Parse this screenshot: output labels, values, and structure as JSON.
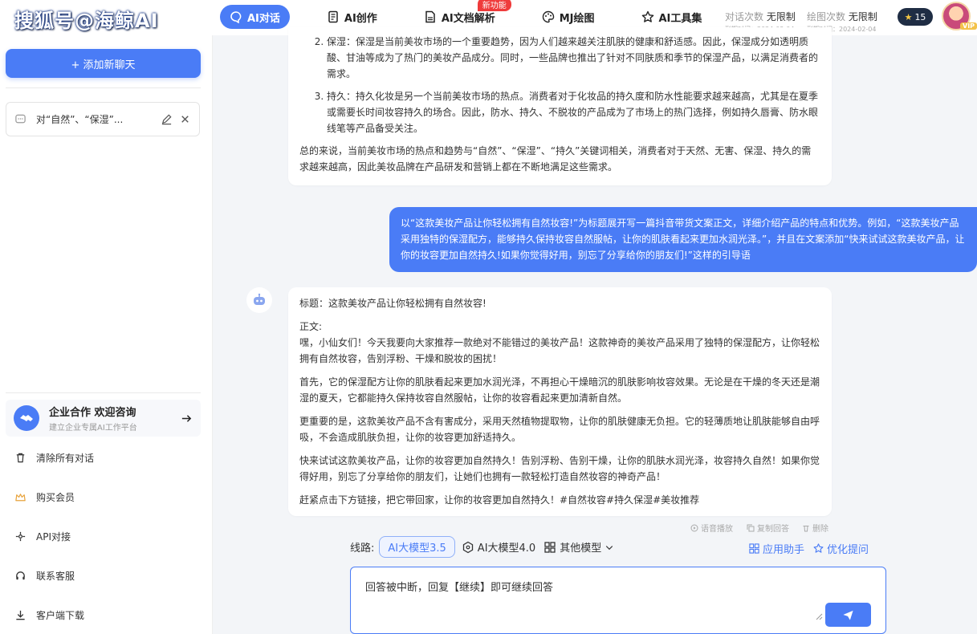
{
  "watermark": "搜狐号@海鲸AI",
  "nav": {
    "items": [
      {
        "label": "AI对话",
        "icon": "chat-icon",
        "active": true
      },
      {
        "label": "AI创作",
        "icon": "doc-icon"
      },
      {
        "label": "AI文档解析",
        "icon": "pdf-icon",
        "badge": "新功能"
      },
      {
        "label": "MJ绘图",
        "icon": "palette-icon"
      },
      {
        "label": "AI工具集",
        "icon": "star-icon"
      }
    ]
  },
  "quota": {
    "chat": {
      "label": "对话次数",
      "value": "无限制",
      "expiry": "到期时间：2024-02-04"
    },
    "draw": {
      "label": "绘图次数",
      "value": "无限制",
      "expiry": "到期时间：2024-02-04"
    }
  },
  "coins": "15",
  "vip_label": "VIP",
  "sidebar": {
    "add_chat": "+ 添加新聊天",
    "chat_item": "对“自然”、“保湿”...",
    "enterprise": {
      "title": "企业合作 欢迎咨询",
      "subtitle": "建立企业专属AI工作平台"
    },
    "menu": [
      {
        "label": "清除所有对话",
        "icon": "trash-icon"
      },
      {
        "label": "购买会员",
        "icon": "crown-icon"
      },
      {
        "label": "API对接",
        "icon": "api-icon"
      },
      {
        "label": "联系客服",
        "icon": "headset-icon"
      },
      {
        "label": "客户端下载",
        "icon": "download-icon"
      }
    ]
  },
  "messages": {
    "prev_bot": {
      "list": [
        {
          "num": "2.",
          "text": "保湿：保湿是当前美妆市场的一个重要趋势，因为人们越来越关注肌肤的健康和舒适感。因此，保湿成分如透明质酸、甘油等成为了热门的美妆产品成分。同时，一些品牌也推出了针对不同肤质和季节的保湿产品，以满足消费者的需求。"
        },
        {
          "num": "3.",
          "text": "持久：持久化妆是另一个当前美妆市场的热点。消费者对于化妆品的持久度和防水性能要求越来越高，尤其是在夏季或需要长时间妆容持久的场合。因此，防水、持久、不脱妆的产品成为了市场上的热门选择，例如持久唇膏、防水眼线笔等产品备受关注。"
        }
      ],
      "summary": "总的来说，当前美妆市场的热点和趋势与“自然”、“保湿”、“持久”关键词相关，消费者对于天然、无害、保湿、持久的需求越来越高，因此美妆品牌在产品研发和营销上都在不断地满足这些需求。"
    },
    "user": "以“这款美妆产品让你轻松拥有自然妆容!”为标题展开写一篇抖音带货文案正文，详细介绍产品的特点和优势。例如，“这款美妆产品采用独特的保湿配方，能够持久保持妆容自然服帖，让你的肌肤看起来更加水润光泽。”，并且在文案添加“快来试试这款美妆产品，让你的妆容更加自然持久!如果你觉得好用，别忘了分享给你的朋友们!”这样的引导语",
    "bot": {
      "title": "标题：这款美妆产品让你轻松拥有自然妆容!",
      "body_label": "正文:",
      "p1": "嘿，小仙女们！今天我要向大家推荐一款绝对不能错过的美妆产品！这款神奇的美妆产品采用了独特的保湿配方，让你轻松拥有自然妆容，告别浮粉、干燥和脱妆的困扰！",
      "p2": "首先，它的保湿配方让你的肌肤看起来更加水润光泽，不再担心干燥暗沉的肌肤影响妆容效果。无论是在干燥的冬天还是潮湿的夏天，它都能持久保持妆容自然服帖，让你的妆容看起来更加清新自然。",
      "p3": "更重要的是，这款美妆产品不含有害成分，采用天然植物提取物，让你的肌肤健康无负担。它的轻薄质地让肌肤能够自由呼吸，不会造成肌肤负担，让你的妆容更加舒适持久。",
      "p4": "快来试试这款美妆产品，让你的妆容更加自然持久！告别浮粉、告别干燥，让你的肌肤水润光泽，妆容持久自然！如果你觉得好用，别忘了分享给你的朋友们，让她们也拥有一款轻松打造自然妆容的神奇产品！",
      "p5": "赶紧点击下方链接，把它带回家，让你的妆容更加自然持久！#自然妆容#持久保湿#美妆推荐"
    },
    "actions": {
      "voice": "语音播放",
      "copy": "复制回答",
      "delete": "删除"
    }
  },
  "route": {
    "label": "线路:",
    "models": [
      "AI大模型3.5",
      "AI大模型4.0",
      "其他模型"
    ],
    "selected": "AI大模型3.5"
  },
  "tools": {
    "app_helper": "应用助手",
    "optimize": "优化提问"
  },
  "input": {
    "value": "回答被中断，回复【继续】即可继续回答"
  }
}
